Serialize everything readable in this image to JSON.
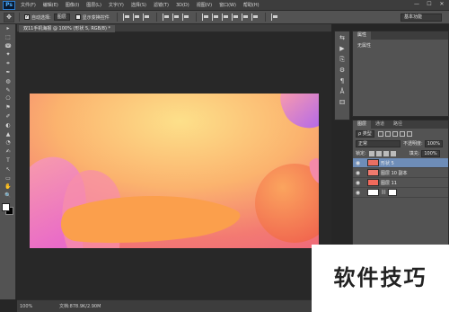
{
  "app": {
    "logo": "Ps",
    "menu": [
      "文件(F)",
      "编辑(E)",
      "图像(I)",
      "图层(L)",
      "文字(Y)",
      "选择(S)",
      "滤镜(T)",
      "3D(D)",
      "视图(V)",
      "窗口(W)",
      "帮助(H)"
    ],
    "window_controls": [
      "—",
      "☐",
      "✕"
    ]
  },
  "options_bar": {
    "tool_glyph": "✥",
    "auto_select_label": "自动选择:",
    "auto_select_value": "图层",
    "show_transform_label": "显示变换控件",
    "workspace": "基本功能"
  },
  "tools": [
    "▸",
    "⬚",
    "ↈ",
    "✦",
    "⌗",
    "✒",
    "◍",
    "✎",
    "⎔",
    "⚑",
    "✐",
    "◐",
    "▲",
    "◔",
    "✍",
    "T",
    "↖",
    "▭",
    "✋",
    "🔍"
  ],
  "colors": {
    "foreground": "#ffffff",
    "background": "#000000",
    "accent": "#6e8db8"
  },
  "document": {
    "tab_title": "双11手机海报 @ 100% (形状 5, RGB/8) *",
    "zoom": "100%",
    "info": "文档:878.9K/2.90M"
  },
  "dock_icons": [
    "⇆",
    "▶",
    "⎘",
    "⚙",
    "¶",
    "Å",
    "⚃"
  ],
  "properties_panel": {
    "tabs": [
      "属性"
    ],
    "empty_text": "无属性"
  },
  "layers_panel": {
    "tabs": [
      "图层",
      "通道",
      "路径"
    ],
    "filter_kind": "ρ 类型",
    "blend_mode": "正常",
    "opacity_label": "不透明度:",
    "opacity_value": "100%",
    "lock_label": "锁定:",
    "fill_label": "填充:",
    "fill_value": "100%",
    "layers": [
      {
        "name": "形状 5",
        "selected": true,
        "thumb": "#e96f63"
      },
      {
        "name": "图层 10 副本",
        "selected": false,
        "thumb": "#f07a6e"
      },
      {
        "name": "图层 11",
        "selected": false,
        "thumb": "#f26a5c"
      },
      {
        "name": "",
        "selected": false,
        "thumb": "#ffffff"
      }
    ]
  },
  "watermark": "软件技巧"
}
